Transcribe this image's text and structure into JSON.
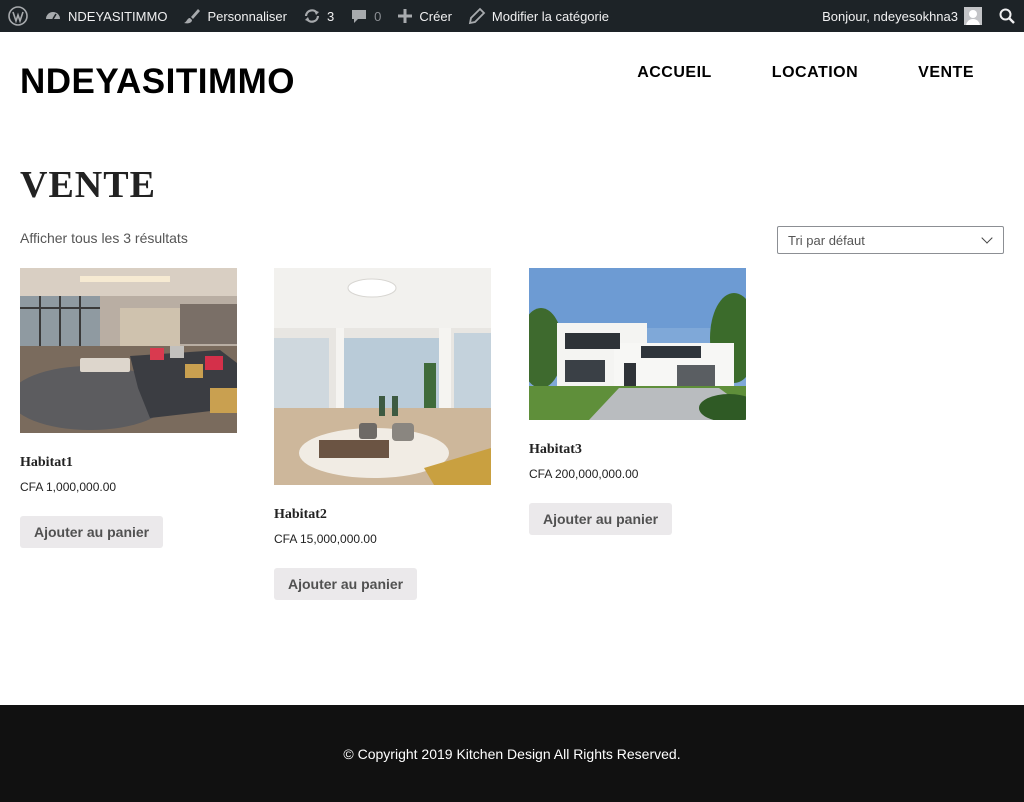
{
  "adminbar": {
    "site_name": "NDEYASITIMMO",
    "customize": "Personnaliser",
    "updates_count": "3",
    "comments_count": "0",
    "new": "Créer",
    "edit_category": "Modifier la catégorie",
    "greeting": "Bonjour, ndeyesokhna3"
  },
  "header": {
    "title": "NDEYASITIMMO",
    "nav": [
      "ACCUEIL",
      "LOCATION",
      "VENTE"
    ]
  },
  "page": {
    "title": "VENTE",
    "result_count": "Afficher tous les 3 résultats",
    "ordering": "Tri par défaut"
  },
  "products": [
    {
      "name": "Habitat1",
      "price": "CFA 1,000,000.00",
      "button": "Ajouter au panier"
    },
    {
      "name": "Habitat2",
      "price": "CFA 15,000,000.00",
      "button": "Ajouter au panier"
    },
    {
      "name": "Habitat3",
      "price": "CFA 200,000,000.00",
      "button": "Ajouter au panier"
    }
  ],
  "footer": {
    "copyright": "© Copyright 2019 Kitchen Design All Rights Reserved."
  }
}
